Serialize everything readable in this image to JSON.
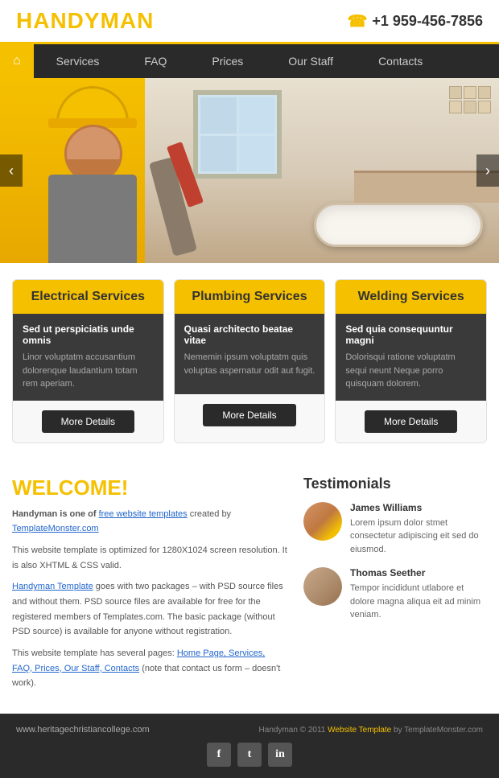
{
  "header": {
    "logo_prefix": "HANDY",
    "logo_suffix": "MAN",
    "phone_icon": "☎",
    "phone_number": "+1 959-456-7856"
  },
  "nav": {
    "home_icon": "⌂",
    "items": [
      {
        "label": "Services",
        "id": "services"
      },
      {
        "label": "FAQ",
        "id": "faq"
      },
      {
        "label": "Prices",
        "id": "prices"
      },
      {
        "label": "Our Staff",
        "id": "ourstaff"
      },
      {
        "label": "Contacts",
        "id": "contacts"
      }
    ]
  },
  "slider": {
    "prev": "‹",
    "next": "›"
  },
  "services": [
    {
      "id": "electrical",
      "title": "Electrical Services",
      "sub_heading": "Sed ut perspiciatis unde omnis",
      "description": "Linor voluptatm accusantium dolorenque laudantium totam rem aperiam.",
      "button_label": "More Details"
    },
    {
      "id": "plumbing",
      "title": "Plumbing Services",
      "sub_heading": "Quasi architecto beatae vitae",
      "description": "Nememin ipsum voluptatm quis voluptas aspernatur odit aut fugit.",
      "button_label": "More Details"
    },
    {
      "id": "welding",
      "title": "Welding Services",
      "sub_heading": "Sed quia consequuntur magni",
      "description": "Dolorisqui ratione voluptatm sequi neunt Neque porro quisquam dolorem.",
      "button_label": "More Details"
    }
  ],
  "welcome": {
    "heading": "WELCOME!",
    "intro_bold": "Handyman is one of",
    "intro_link": "free website templates",
    "intro_link2": "TemplateMonster.com",
    "intro_rest": "created by TemplateMonster.com",
    "para1": "This website template is optimized for 1280X1024 screen resolution. It is also XHTML & CSS valid.",
    "handyman_link": "Handyman Template",
    "para2": "goes with two packages – with PSD source files and without them. PSD source files are available for free for the registered members of Templates.com. The basic package (without PSD source) is available for anyone without registration.",
    "para3_start": "This website template has several pages:",
    "page_links": "Home Page, Services, FAQ, Prices, Our Staff, Contacts",
    "para3_note": "(note that contact us form – doesn't work)."
  },
  "testimonials": {
    "heading": "Testimonials",
    "items": [
      {
        "name": "James Williams",
        "text": "Lorem ipsum dolor stmet consectetur adipiscing eit sed do eiusmod."
      },
      {
        "name": "Thomas Seether",
        "text": "Tempor incididunt utlabore et dolore magna aliqua eit ad minim veniam."
      }
    ]
  },
  "footer": {
    "url": "www.heritagechristiancollege.com",
    "copy": "Handyman © 2011",
    "template_link": "Website Template",
    "copy_rest": "by TemplateMonster.com",
    "social": [
      {
        "label": "f",
        "id": "facebook"
      },
      {
        "label": "t",
        "id": "twitter"
      },
      {
        "label": "in",
        "id": "linkedin"
      }
    ]
  }
}
